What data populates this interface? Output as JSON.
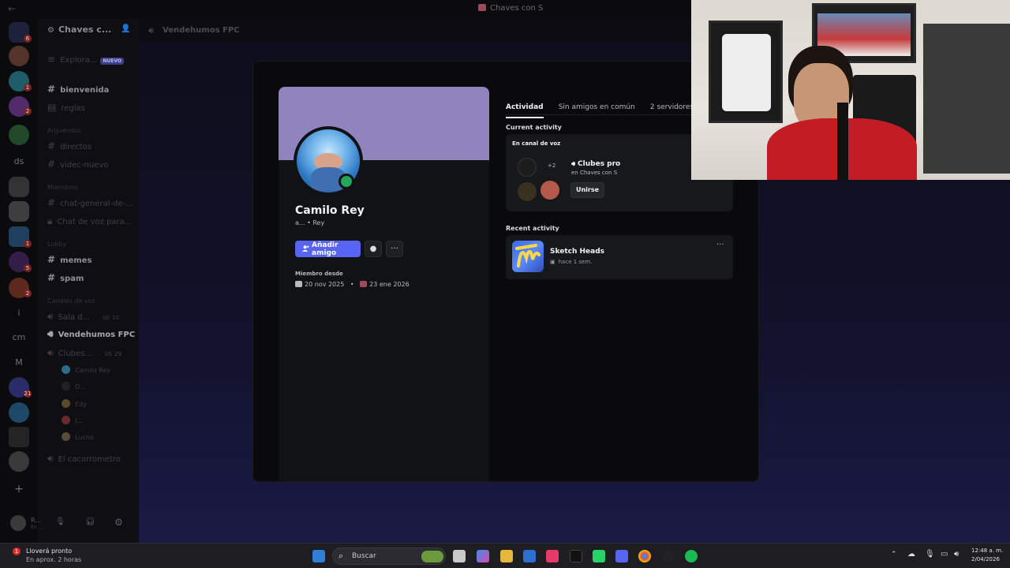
{
  "window": {
    "title": "Chaves con S"
  },
  "server": {
    "name": "Chaves c..."
  },
  "sidebar": {
    "explore": {
      "label": "Explora...",
      "badge": "NUEVO"
    },
    "channels_top": [
      {
        "label": "bienvenida"
      },
      {
        "label": "reglas"
      }
    ],
    "category_1": "Arguendos",
    "channels_mid": [
      {
        "label": "directos"
      },
      {
        "label": "videc-nuevo"
      }
    ],
    "category_2": "Miembros",
    "channels_members": [
      {
        "label": "chat-general-de-..."
      },
      {
        "label": "Chat de voz para..."
      }
    ],
    "category_3": "Lobby",
    "channels_lobby": [
      {
        "label": "memes"
      },
      {
        "label": "spam"
      }
    ],
    "category_4": "Canales de voz",
    "voice_channels": [
      {
        "label": "Sala d...",
        "count_a": "00",
        "count_b": "10"
      },
      {
        "label": "Vendehumos FPC"
      },
      {
        "label": "Clubes...",
        "count_a": "05",
        "count_b": "29"
      }
    ],
    "voice_members": [
      {
        "name": "Camilo Rey"
      },
      {
        "name": "D..."
      },
      {
        "name": "Edy"
      },
      {
        "name": "J..."
      },
      {
        "name": "Lucho"
      }
    ],
    "last_channel": "El cacorrometro",
    "user": {
      "name": "R...",
      "status": "En ..."
    }
  },
  "rail": {
    "badges": [
      "6",
      "1",
      "2",
      "1",
      "5",
      "2",
      "21"
    ],
    "text_servers": [
      "ds",
      "i",
      "cm",
      "M"
    ]
  },
  "header": {
    "channel": "Vendehumos FPC"
  },
  "profile": {
    "name": "Camilo Rey",
    "subtitle": "a...  •  Rey",
    "add_friend": "Añadir amigo",
    "more_glyph": "···",
    "member_since_label": "Miembro desde",
    "discord_date": "20 nov 2025",
    "separator": "•",
    "server_date": "23 ene 2026"
  },
  "tabs": [
    {
      "label": "Actividad"
    },
    {
      "label": "Sin amigos en común"
    },
    {
      "label": "2 servidores en com"
    }
  ],
  "current_activity": {
    "title": "Current activity",
    "card_label": "En canal de voz",
    "plus": "+2",
    "channel_name": "Clubes pro",
    "channel_sub": "en Chaves con S",
    "join": "Unirse"
  },
  "recent_activity": {
    "title": "Recent activity",
    "game": "Sketch Heads",
    "when": "hace 1 sem.",
    "more": "···"
  },
  "taskbar": {
    "weather_line1": "Lloverá pronto",
    "weather_line2": "En aprox. 2 horas",
    "weather_badge": "1",
    "search": "Buscar",
    "time": "12:48 a. m.",
    "date": "2/04/2026"
  },
  "colors": {
    "accent": "#5865f2",
    "banner": "#8f84bd",
    "online": "#23a55a"
  }
}
